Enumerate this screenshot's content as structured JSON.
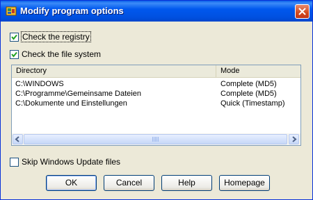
{
  "window": {
    "title": "Modify program options",
    "accent_color": "#0054e3"
  },
  "options": {
    "check_registry": {
      "label": "Check the registry",
      "checked": true
    },
    "check_filesystem": {
      "label": "Check the file system",
      "checked": true
    },
    "skip_windows_update": {
      "label": "Skip Windows Update files",
      "checked": false
    }
  },
  "directories": {
    "columns": [
      "Directory",
      "Mode"
    ],
    "rows": [
      {
        "directory": "C:\\WINDOWS",
        "mode": "Complete (MD5)"
      },
      {
        "directory": "C:\\Programme\\Gemeinsame Dateien",
        "mode": "Complete (MD5)"
      },
      {
        "directory": "C:\\Dokumente und Einstellungen",
        "mode": "Quick (Timestamp)"
      }
    ]
  },
  "buttons": {
    "ok": "OK",
    "cancel": "Cancel",
    "help": "Help",
    "homepage": "Homepage"
  },
  "icons": {
    "app": "program-icon",
    "close": "close-icon",
    "scroll_left": "arrow-left-icon",
    "scroll_right": "arrow-right-icon"
  }
}
